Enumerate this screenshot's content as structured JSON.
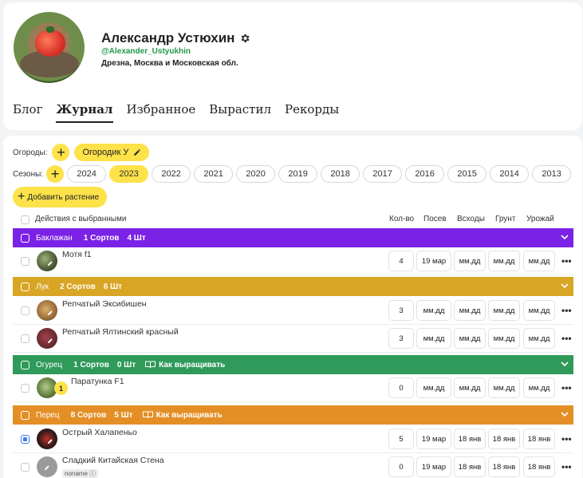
{
  "profile": {
    "name": "Александр Устюхин",
    "handle": "@Alexander_Ustyukhin",
    "location": "Дрезна, Москва и Московская обл."
  },
  "tabs": [
    "Блог",
    "Журнал",
    "Избранное",
    "Вырастил",
    "Рекорды"
  ],
  "active_tab": "Журнал",
  "gardens": {
    "label": "Огороды:",
    "current": "Огородик У"
  },
  "seasons": {
    "label": "Сезоны:",
    "years": [
      "2024",
      "2023",
      "2022",
      "2021",
      "2020",
      "2019",
      "2018",
      "2017",
      "2016",
      "2015",
      "2014",
      "2013"
    ],
    "active": "2023"
  },
  "add_plant_label": "Добавить растение",
  "table_header": {
    "bulk_actions": "Действия с выбранными",
    "qty": "Кол-во",
    "sow": "Посев",
    "shoots": "Всходы",
    "ground": "Грунт",
    "yield": "Урожай"
  },
  "groups": [
    {
      "name": "Баклажан",
      "sorts": "1 Сортов",
      "qty": "4 Шт",
      "color": "#7b22e6",
      "howto": "",
      "plants": [
        {
          "name": "Мотя f1",
          "qty": "4",
          "sow": "19 мар",
          "shoots": "мм.дд",
          "ground": "мм.дд",
          "yield": "мм.дд"
        }
      ]
    },
    {
      "name": "Лук",
      "sorts": "2 Сортов",
      "qty": "6 Шт",
      "color": "#d8a524",
      "howto": "",
      "plants": [
        {
          "name": "Репчатый Эксибишен",
          "qty": "3",
          "sow": "мм.дд",
          "shoots": "мм.дд",
          "ground": "мм.дд",
          "yield": "мм.дд"
        },
        {
          "name": "Репчатый Ялтинский красный",
          "qty": "3",
          "sow": "мм.дд",
          "shoots": "мм.дд",
          "ground": "мм.дд",
          "yield": "мм.дд"
        }
      ]
    },
    {
      "name": "Огурец",
      "sorts": "1 Сортов",
      "qty": "0 Шт",
      "color": "#2f9a5a",
      "howto": "Как выращивать",
      "plants": [
        {
          "name": "Паратунка F1",
          "qty": "0",
          "sow": "мм.дд",
          "shoots": "мм.дд",
          "ground": "мм.дд",
          "yield": "мм.дд",
          "badge": "1"
        }
      ]
    },
    {
      "name": "Перец",
      "sorts": "8 Сортов",
      "qty": "5 Шт",
      "color": "#e38f26",
      "howto": "Как выращивать",
      "plants": [
        {
          "name": "Острый Халапеньо",
          "qty": "5",
          "sow": "19 мар",
          "shoots": "18 янв",
          "ground": "18 янв",
          "yield": "18 янв"
        },
        {
          "name": "Сладкий Китайская Стена",
          "qty": "0",
          "sow": "19 мар",
          "shoots": "18 янв",
          "ground": "18 янв",
          "yield": "18 янв",
          "tag": "noname"
        }
      ]
    }
  ],
  "icons": [
    "gear-icon",
    "pencil-icon",
    "plus-icon",
    "chevron-down-icon",
    "book-icon",
    "more-icon",
    "help-icon"
  ]
}
